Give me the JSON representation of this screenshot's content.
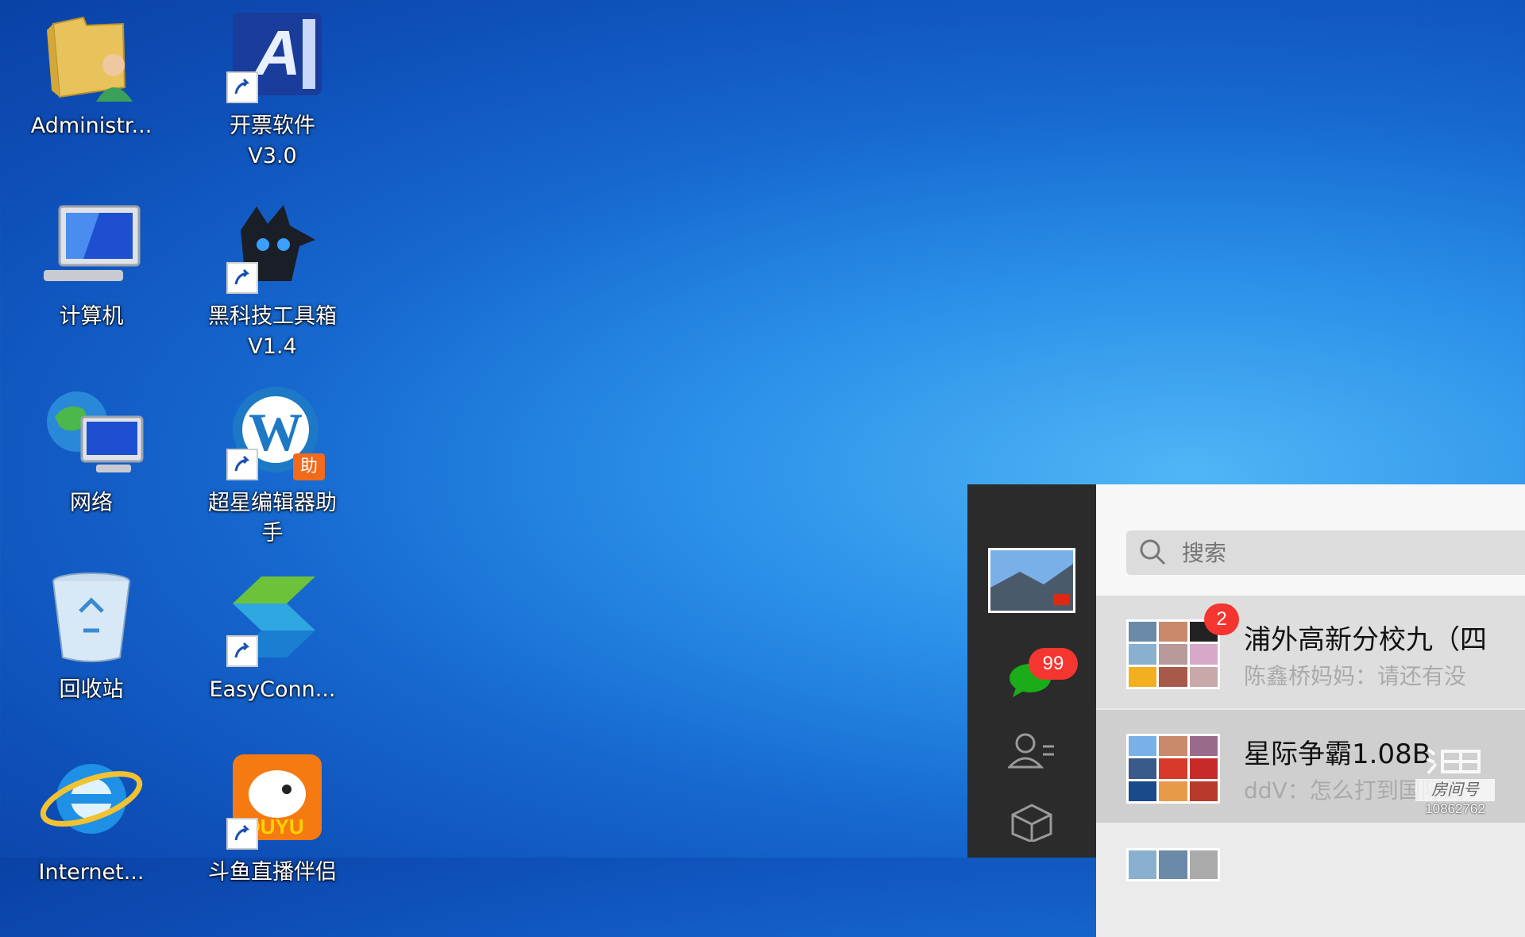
{
  "desktop": {
    "icons": [
      {
        "label": "Administr..."
      },
      {
        "label": "开票软件\nV3.0"
      },
      {
        "label": "计算机"
      },
      {
        "label": "黑科技工具箱\nV1.4"
      },
      {
        "label": "网络"
      },
      {
        "label": "超星编辑器助\n手"
      },
      {
        "label": "回收站"
      },
      {
        "label": "EasyConn..."
      },
      {
        "label": "Internet..."
      },
      {
        "label": "斗鱼直播伴侣"
      }
    ],
    "wp_badge": "助"
  },
  "wechat": {
    "sidebar": {
      "chat_badge": "99"
    },
    "search": {
      "placeholder": "搜索"
    },
    "chats": [
      {
        "title": "浦外高新分校九（四",
        "preview": "陈鑫桥妈妈：请还有没",
        "unread": "2"
      },
      {
        "title": "星际争霸1.08B",
        "preview": "ddV：怎么打到国际局"
      }
    ]
  },
  "watermark": {
    "label": "房间号",
    "room": "10862762"
  },
  "colors": {
    "wechat_sidebar": "#2b2b2b",
    "badge_red": "#f43530",
    "wechat_green": "#1aad19"
  }
}
